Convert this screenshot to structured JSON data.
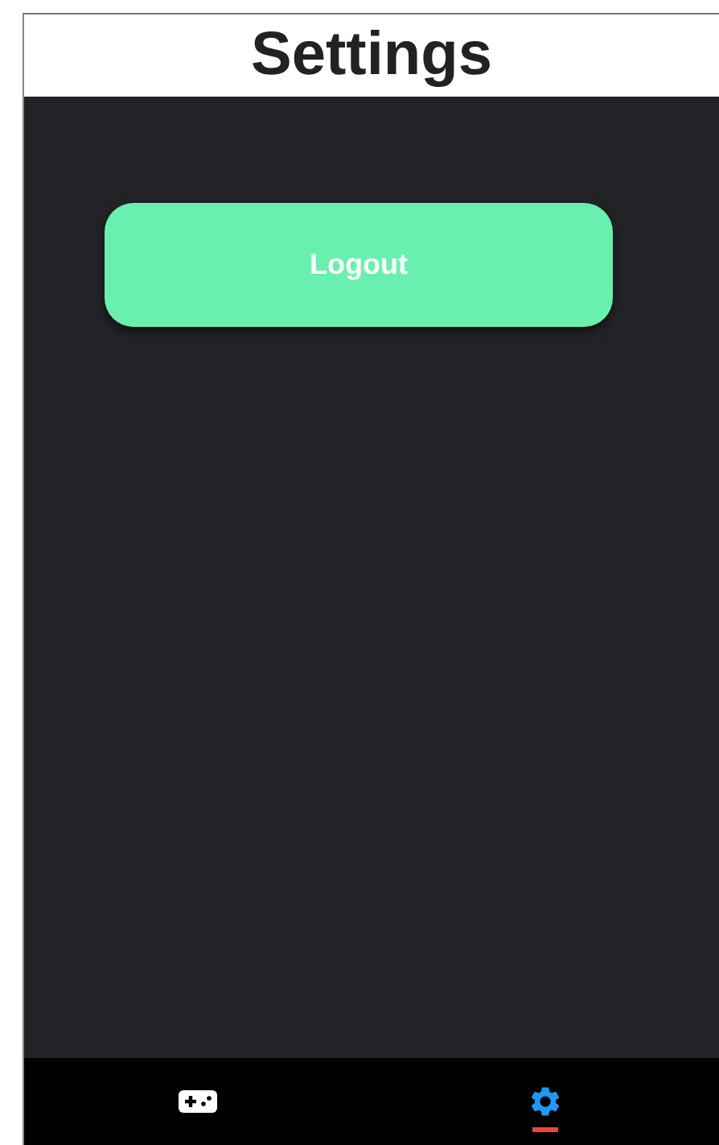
{
  "header": {
    "title": "Settings"
  },
  "logout_button": {
    "label": "Logout"
  },
  "tab_bar": [
    {
      "kind": "gamepad",
      "selected": false
    },
    {
      "kind": "gear",
      "selected": true
    }
  ]
}
